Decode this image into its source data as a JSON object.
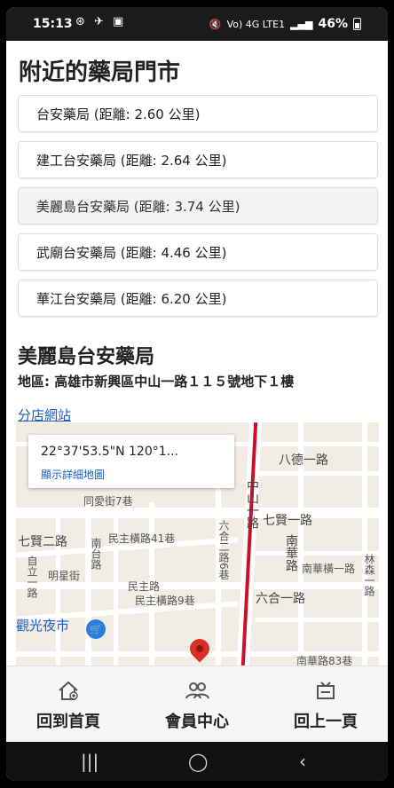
{
  "status_bar": {
    "time": "15:13",
    "network": "Vo) 4G LTE1",
    "battery": "46%"
  },
  "page_title": "附近的藥局門市",
  "stores": [
    {
      "label": "台安藥局 (距離: 2.60 公里)"
    },
    {
      "label": "建工台安藥局 (距離: 2.64 公里)"
    },
    {
      "label": "美麗島台安藥局 (距離: 3.74 公里)"
    },
    {
      "label": "武廟台安藥局 (距離: 4.46 公里)"
    },
    {
      "label": "華江台安藥局 (距離: 6.20 公里)"
    }
  ],
  "selected_store": {
    "name": "美麗島台安藥局",
    "address": "地區: 高雄市新興區中山一路１１５號地下１樓",
    "branch_link": "分店網站"
  },
  "map": {
    "coord": "22°37'53.5\"N 120°1...",
    "more_link": "顯示詳細地圖",
    "labels": {
      "bade_rd": "八德一路",
      "tongai_st": "同愛街7巷",
      "qixian_rd": "七賢二路",
      "qixian_rd1": "七賢一路",
      "minzu_st41": "民主橫路41巷",
      "nantai_rd": "南台路",
      "ziliyi_rd": "自立一路",
      "mingxing_st": "明星街",
      "minzhu_rd": "民主路",
      "minzhu_rd9": "民主橫路9巷",
      "zhongshan_rd": "中山一路",
      "liuhe_rd2": "六合二路6巷",
      "liuhe_rd1": "六合一路",
      "nanhua_rd": "南華路",
      "nanhua_heng": "南華橫一路",
      "nanhua_83": "南華路83巷",
      "linsen_rd": "林森一路",
      "night_market": "觀光夜市"
    },
    "colors": {
      "main_road": "#c8102e",
      "road": "#ffffff",
      "block": "#f2ede4",
      "accent": "#1a5fc4"
    }
  },
  "bottom_nav": {
    "home": "回到首頁",
    "member": "會員中心",
    "back": "回上一頁"
  }
}
